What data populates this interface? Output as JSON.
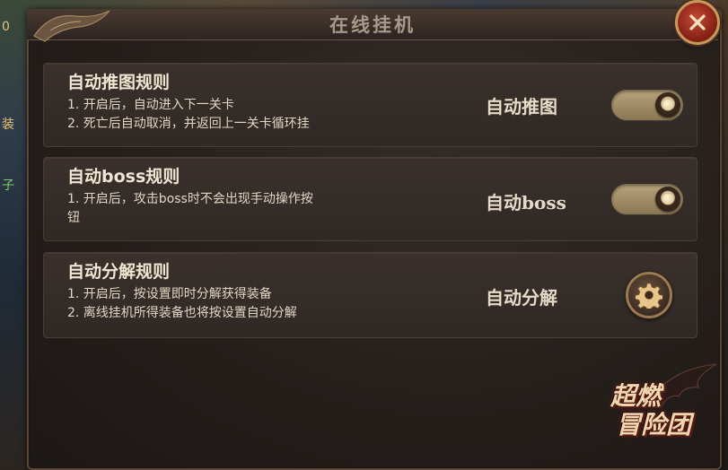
{
  "window": {
    "title": "在线挂机"
  },
  "background": {
    "edge_chars": [
      "0",
      "装",
      "子"
    ]
  },
  "rules": [
    {
      "title": "自动推图规则",
      "lines": [
        "1. 开启后，自动进入下一关卡",
        "2. 死亡后自动取消，并返回上一关卡循环挂"
      ],
      "label": "自动推图",
      "control": "toggle",
      "enabled": true
    },
    {
      "title": "自动boss规则",
      "lines": [
        "1. 开启后，攻击boss时不会出现手动操作按",
        "钮"
      ],
      "label": "自动boss",
      "control": "toggle",
      "enabled": true
    },
    {
      "title": "自动分解规则",
      "lines": [
        "1. 开启后，按设置即时分解获得装备",
        "2. 离线挂机所得装备也将按设置自动分解"
      ],
      "label": "自动分解",
      "control": "gear-icon"
    }
  ],
  "logo": {
    "line1": "超燃",
    "line2": "冒险团"
  },
  "colors": {
    "accent_gold": "#c79a5c",
    "close_red": "#8c2418",
    "toggle_on": "#b8a47c"
  }
}
